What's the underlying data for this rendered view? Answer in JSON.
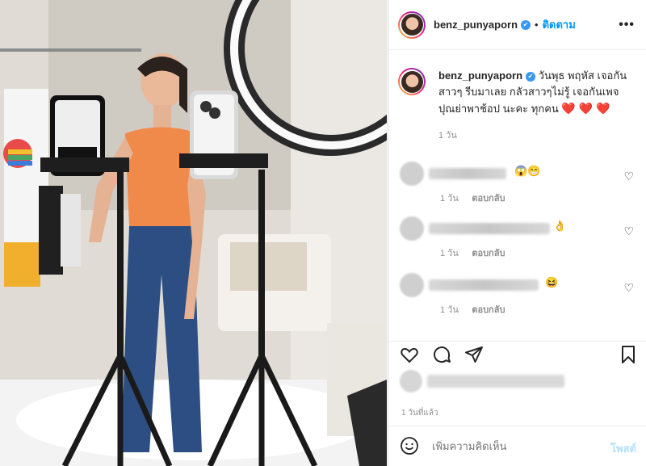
{
  "header": {
    "username": "benz_punyaporn",
    "verified_icon": "✔",
    "separator": "•",
    "follow_label": "ติดตาม",
    "more_label": "•••"
  },
  "caption": {
    "username": "benz_punyaporn",
    "text": "วันพุธ พฤหัส เจอกันสาวๆ รีบมาเลย กลัวสาวๆไม่รู้ เจอกันเพจ ปุณย่าพาช้อป นะคะ ทุกคน",
    "hearts": "❤️ ❤️ ❤️",
    "time": "1 วัน"
  },
  "comments": [
    {
      "emoji": "😱😁",
      "time": "1 วัน",
      "reply": "ตอบกลับ"
    },
    {
      "emoji": "👌",
      "time": "1 วัน",
      "reply": "ตอบกลับ"
    },
    {
      "emoji": "😆",
      "time": "1 วัน",
      "reply": "ตอบกลับ"
    }
  ],
  "post_time": "1 วันที่แล้ว",
  "add_comment": {
    "placeholder": "เพิ่มความคิดเห็น",
    "post_label": "โพสต์"
  },
  "colors": {
    "link_blue": "#0095f6",
    "post_disabled": "#b2dffc",
    "muted": "#8e8e8e"
  }
}
